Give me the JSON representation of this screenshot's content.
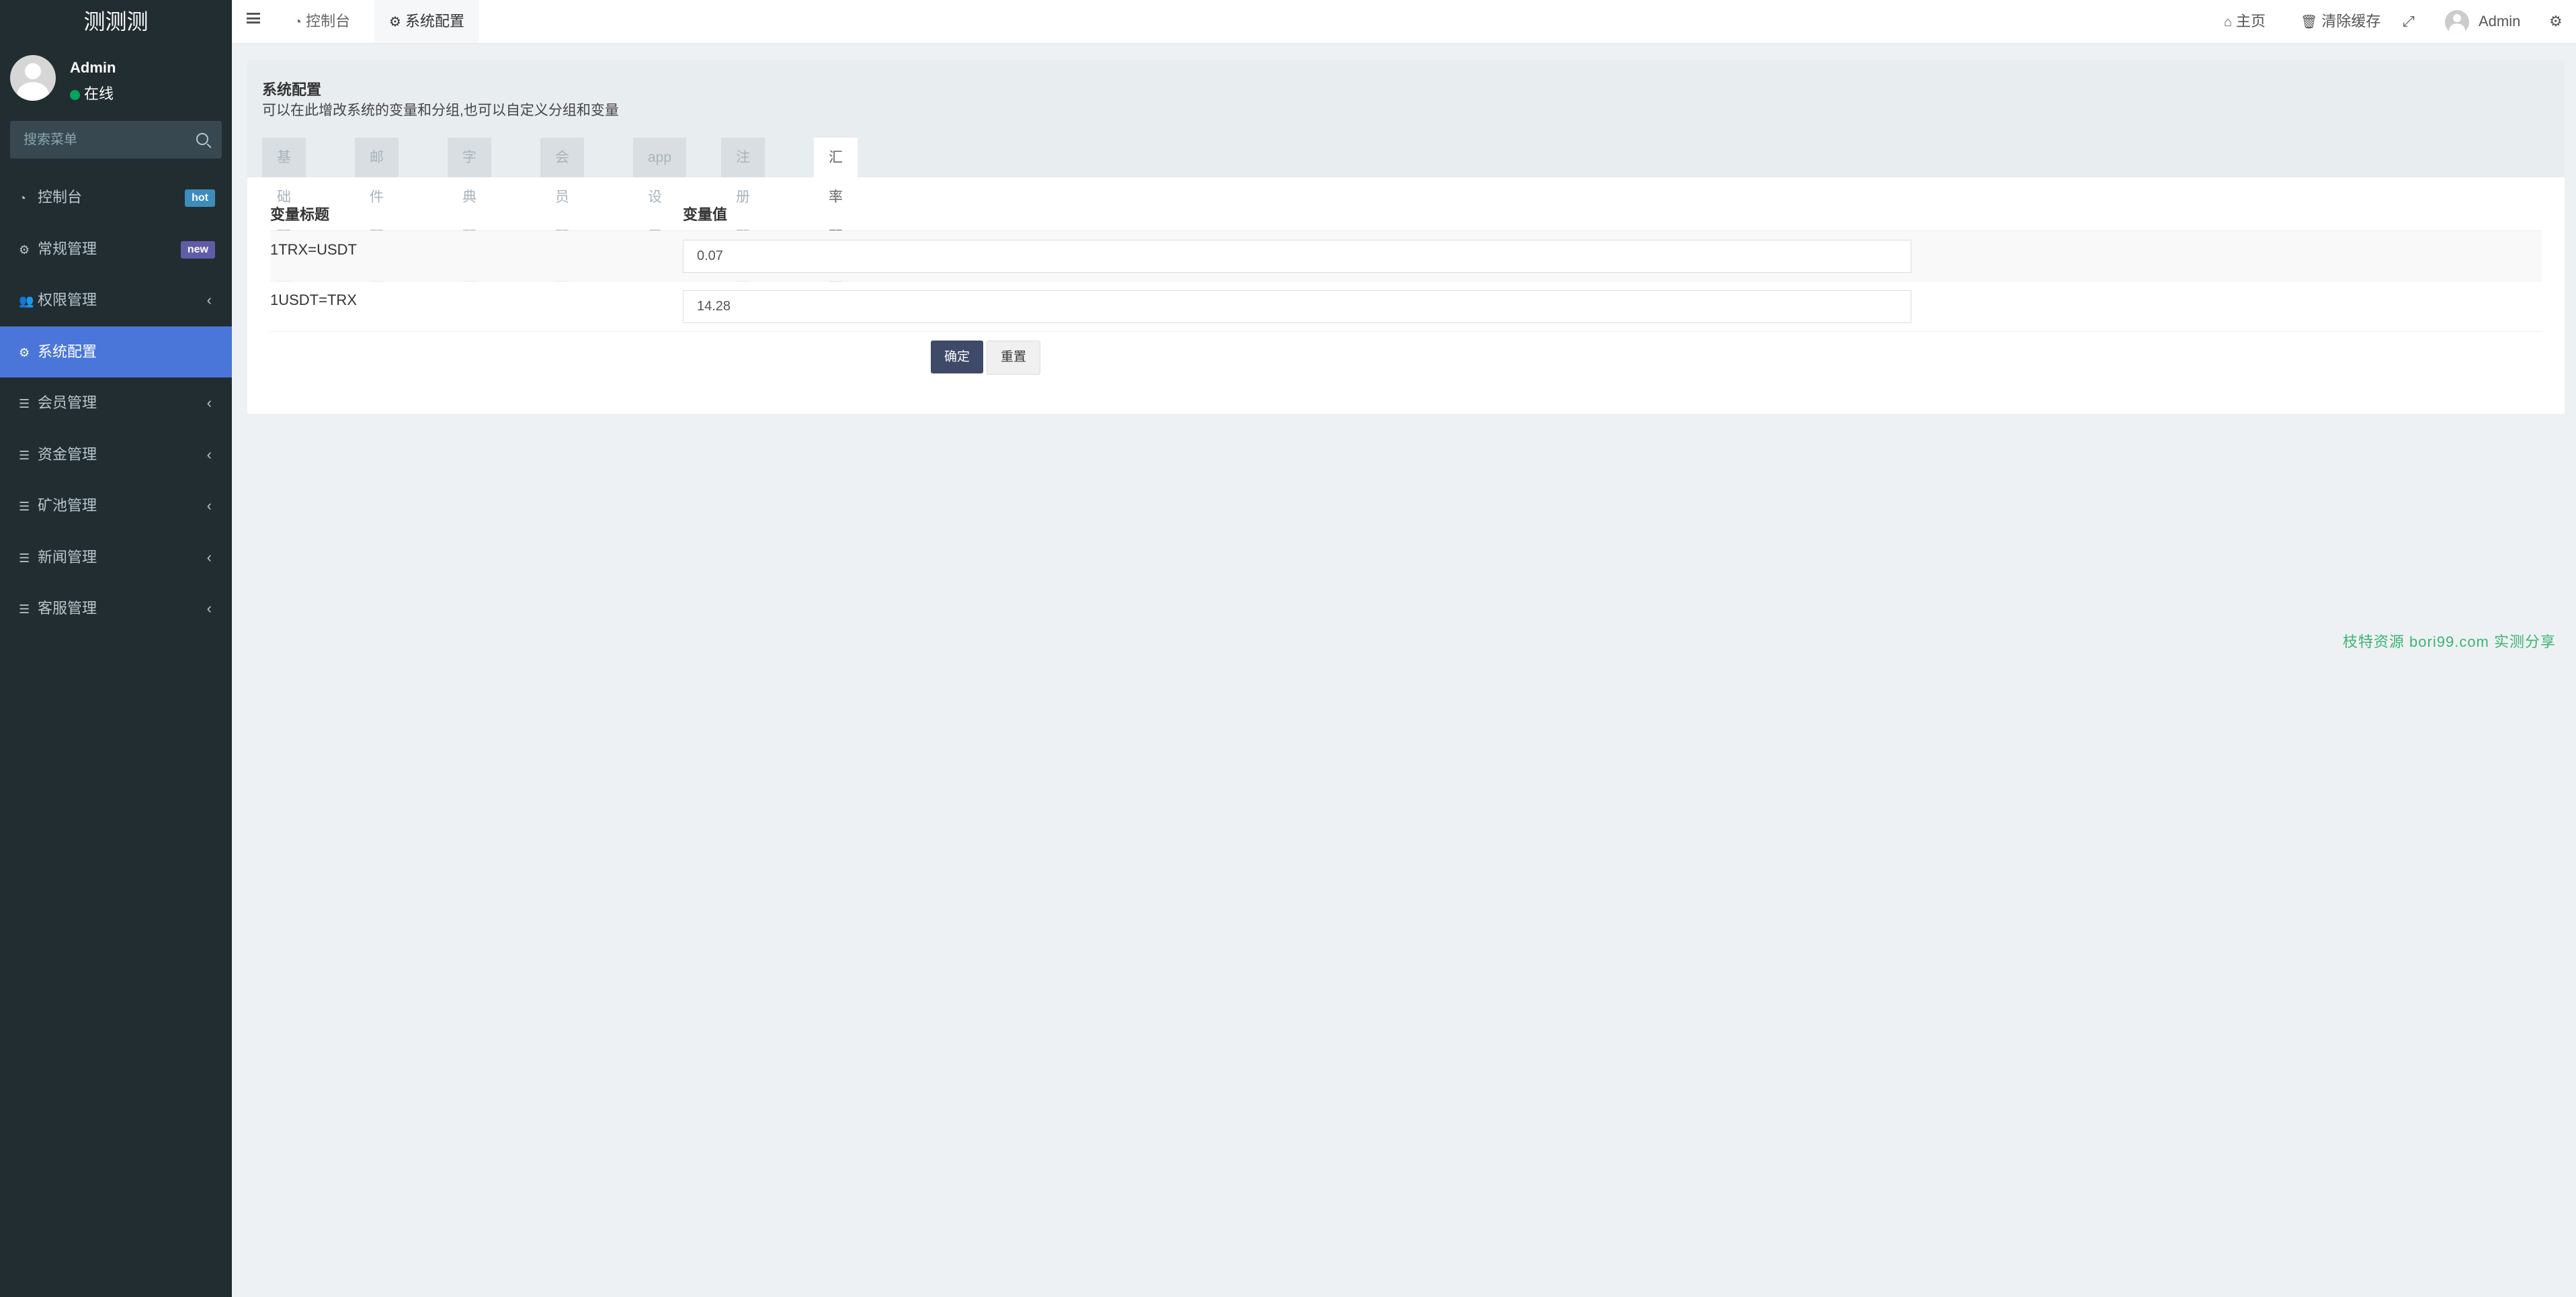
{
  "app": {
    "logo": "测测测",
    "user": {
      "name": "Admin",
      "status": "在线"
    },
    "search_placeholder": "搜索菜单"
  },
  "sidebar": {
    "items": [
      {
        "label": "控制台",
        "icon": "dashboard-icon",
        "badge": "hot"
      },
      {
        "label": "常规管理",
        "icon": "cogs-icon",
        "badge": "new"
      },
      {
        "label": "权限管理",
        "icon": "users-icon",
        "chevron": "‹"
      },
      {
        "label": "系统配置",
        "icon": "gear-icon"
      },
      {
        "label": "会员管理",
        "icon": "list-icon",
        "chevron": "‹"
      },
      {
        "label": "资金管理",
        "icon": "list-icon",
        "chevron": "‹"
      },
      {
        "label": "矿池管理",
        "icon": "list-icon",
        "chevron": "‹"
      },
      {
        "label": "新闻管理",
        "icon": "list-icon",
        "chevron": "‹"
      },
      {
        "label": "客服管理",
        "icon": "list-icon",
        "chevron": "‹"
      }
    ],
    "active_item": "系统配置"
  },
  "header": {
    "tabs": [
      {
        "label": "控制台",
        "icon": "dashboard-icon"
      },
      {
        "label": "系统配置",
        "icon": "gear-icon"
      }
    ],
    "home_label": "主页",
    "clear_cache_label": "清除缓存",
    "user_name": "Admin"
  },
  "content": {
    "title": "系统配置",
    "description": "可以在此增改系统的变量和分组,也可以自定义分组和变量",
    "tabs": [
      "基础配置",
      "邮件配置",
      "字典配置",
      "会员配置",
      "app设置",
      "注册配置",
      "汇率配置"
    ],
    "active_tab": "汇率配置",
    "table_headers": {
      "title": "变量标题",
      "value": "变量值"
    },
    "rows": [
      {
        "title": "1TRX=USDT",
        "value": "0.07"
      },
      {
        "title": "1USDT=TRX",
        "value": "14.28"
      }
    ],
    "submit_label": "确定",
    "reset_label": "重置"
  },
  "watermark": "枝特资源 bori99.com 实测分享",
  "colors": {
    "sidebar_bg": "#222d32",
    "active_item_bg": "#4a76da",
    "badge_hot": "#3c8dbc",
    "badge_new": "#605ca8",
    "status_online": "#00a65a",
    "submit_button": "#3e4a67",
    "watermark": "#3cb371"
  }
}
